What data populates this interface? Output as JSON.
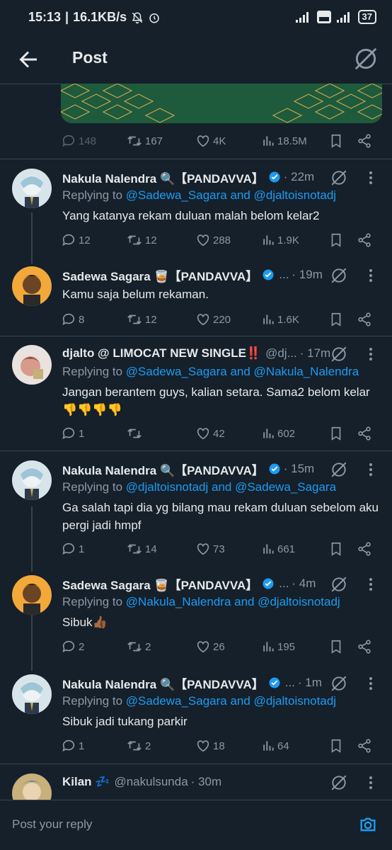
{
  "status": {
    "time": "15:13",
    "speed": "16.1KB/s",
    "battery": "37"
  },
  "header": {
    "title": "Post"
  },
  "colors": {
    "bg": "#15202b",
    "accent": "#1d9bf0",
    "muted": "#8b98a5",
    "text": "#e7e9ea",
    "divider": "#38444d"
  },
  "main_metrics": {
    "replies": "148",
    "retweets": "167",
    "likes": "4K",
    "views": "18.5M"
  },
  "tweets": [
    {
      "name": "Nakula Nalendra 🔍【PANDAVVA】",
      "handle": "",
      "time": "· 22m",
      "reply_prefix": "Replying to ",
      "reply_to": "@Sadewa_Sagara and @djaltoisnotadj",
      "text": "Yang katanya rekam duluan malah belom kelar2",
      "replies": "12",
      "retweets": "12",
      "likes": "288",
      "views": "1.9K"
    },
    {
      "name": "Sadewa Sagara 🥃【PANDAVVA】",
      "handle": "...",
      "time": "· 19m",
      "text": "Kamu saja belum rekaman.",
      "replies": "8",
      "retweets": "12",
      "likes": "220",
      "views": "1.6K"
    },
    {
      "name": "djalto @ LIMOCAT NEW SINGLE‼️",
      "handle": "@dj...",
      "time": "· 17m",
      "reply_prefix": "Replying to ",
      "reply_to": "@Sadewa_Sagara and @Nakula_Nalendra",
      "text": "Jangan berantem guys, kalian setara. Sama2 belom kelar 👎👎👎👎",
      "replies": "1",
      "retweets": "",
      "likes": "42",
      "views": "602"
    },
    {
      "name": "Nakula Nalendra 🔍【PANDAVVA】",
      "handle": "",
      "time": "· 15m",
      "reply_prefix": "Replying to ",
      "reply_to": "@djaltoisnotadj and @Sadewa_Sagara",
      "text": "Ga salah tapi dia yg bilang mau rekam duluan sebelom aku pergi jadi hmpf",
      "replies": "1",
      "retweets": "14",
      "likes": "73",
      "views": "661"
    },
    {
      "name": "Sadewa Sagara 🥃【PANDAVVA】",
      "handle": "...",
      "time": "· 4m",
      "reply_prefix": "Replying to ",
      "reply_to": "@Nakula_Nalendra and @djaltoisnotadj",
      "text": "Sibuk👍🏾",
      "replies": "2",
      "retweets": "2",
      "likes": "26",
      "views": "195"
    },
    {
      "name": "Nakula Nalendra 🔍【PANDAVVA】",
      "handle": "...",
      "time": "· 1m",
      "reply_prefix": "Replying to ",
      "reply_to": "@Sadewa_Sagara and @djaltoisnotadj",
      "text": "Sibuk jadi tukang parkir",
      "replies": "1",
      "retweets": "2",
      "likes": "18",
      "views": "64"
    },
    {
      "name": "Kilan 💤",
      "handle": "@nakulsunda",
      "time": "· 30m"
    }
  ],
  "reply_bar": {
    "placeholder": "Post your reply"
  },
  "icons": [
    "back-arrow-icon",
    "grok-icon",
    "reply-icon",
    "retweet-icon",
    "like-icon",
    "views-icon",
    "bookmark-icon",
    "share-icon",
    "verified-icon",
    "more-icon",
    "camera-icon"
  ]
}
